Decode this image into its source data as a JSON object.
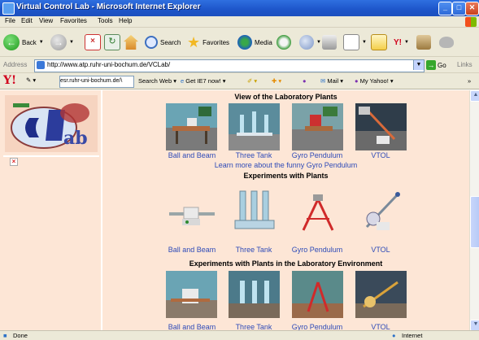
{
  "window": {
    "title": "Virtual Control Lab - Microsoft Internet Explorer",
    "buttons": [
      "_",
      "□",
      "✕"
    ]
  },
  "menu": [
    "File",
    "Edit",
    "View",
    "Favorites",
    "Tools",
    "Help"
  ],
  "toolbar": {
    "back": "Back",
    "search": "Search",
    "favorites": "Favorites",
    "media": "Media"
  },
  "address": {
    "label": "Address",
    "url": "http://www.atp.ruhr-uni-bochum.de/VCLab/",
    "go": "Go",
    "links": "Links"
  },
  "yahoo": {
    "logo": "Y!",
    "search_text": "esr.ruhr-uni-bochum.de/\\",
    "search_web": "Search Web",
    "get_ie7": "Get IE7 now!",
    "mail": "Mail",
    "my_yahoo": "My Yahoo!"
  },
  "icons": {
    "back": "back-arrow-icon",
    "forward": "forward-arrow-icon",
    "stop": "stop-icon",
    "refresh": "refresh-icon",
    "home": "home-icon",
    "search": "search-icon",
    "favorites": "star-icon",
    "media": "media-icon",
    "history": "history-icon",
    "mail": "mail-icon",
    "print": "print-icon",
    "page": "page-icon"
  },
  "colors": {
    "content_bg": "#fde6d6",
    "link": "#2e4bb8",
    "titlebar": "#1d55c9"
  },
  "content": {
    "section1": {
      "title": "View of the Laboratory Plants",
      "items": [
        "Ball and Beam",
        "Three Tank",
        "Gyro Pendulum",
        "VTOL"
      ]
    },
    "more_link": "Learn more about the funny Gyro Pendulum",
    "section2": {
      "title": "Experiments with Plants",
      "items": [
        "Ball and Beam",
        "Three Tank",
        "Gyro Pendulum",
        "VTOL"
      ]
    },
    "section3": {
      "title": "Experiments with Plants in the Laboratory Environment",
      "items": [
        "Ball and Beam",
        "Three Tank",
        "Gyro Pendulum",
        "VTOL"
      ]
    }
  },
  "status": {
    "left": "Done",
    "right": "Internet"
  }
}
